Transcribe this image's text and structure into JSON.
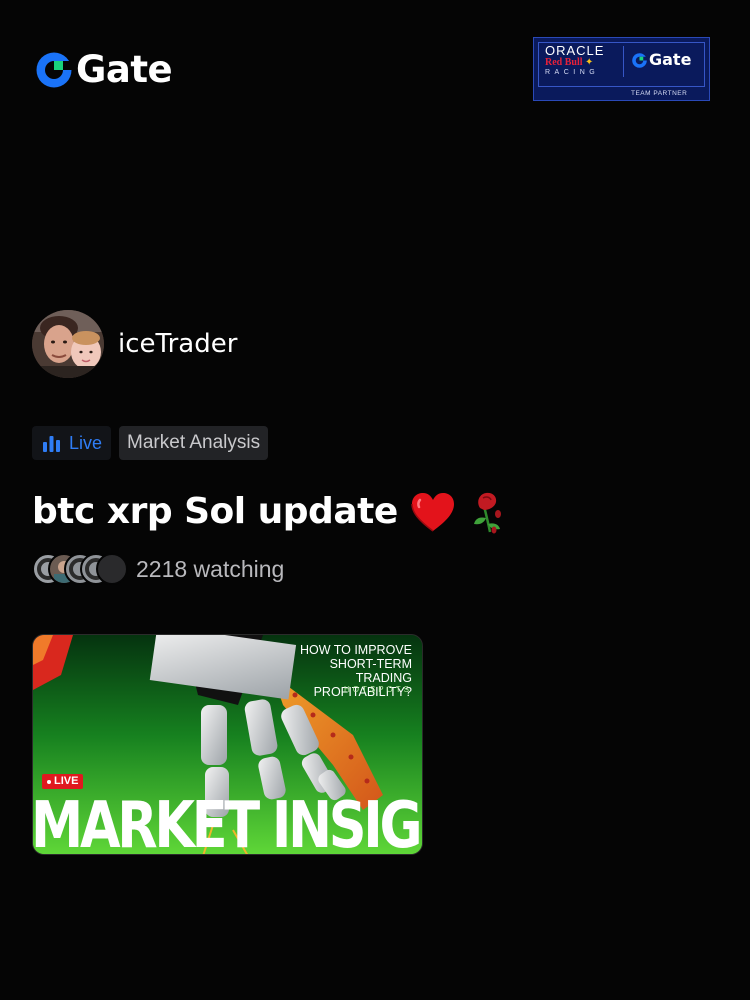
{
  "header": {
    "brand": {
      "name": "Gate",
      "icon": "gate-logo-icon",
      "accent_color": "#1a73f8",
      "highlight_color": "#19d27c"
    },
    "partner_badge": {
      "line1": "ORACLE",
      "line2_a": "Red Bull",
      "line2_b": "✦",
      "line3": "RACING",
      "partner_brand": "Gate",
      "footer": "TEAM PARTNER",
      "background_color": "#0a1a5c"
    }
  },
  "host": {
    "avatar": "host-avatar",
    "name": "iceTrader"
  },
  "tags": {
    "live": {
      "label": "Live",
      "icon": "bar-chart-icon",
      "color": "#2f7df6"
    },
    "category": {
      "label": "Market Analysis"
    }
  },
  "stream": {
    "title": "btc xrp Sol update",
    "emoji": [
      "heart-icon",
      "wilted-rose-icon"
    ]
  },
  "watchers": {
    "count_text": "2218 watching",
    "avatars": [
      "viewer-avatar",
      "viewer-avatar",
      "viewer-avatar",
      "viewer-avatar",
      "viewer-avatar"
    ]
  },
  "thumbnail": {
    "headline": "HOW TO IMPROVE\nSHORT-TERM TRADING\nPROFITABILITY?",
    "subline": "HOTSPOTS",
    "live_badge": "LIVE",
    "brand_text": "MARKET INSIGHT"
  }
}
